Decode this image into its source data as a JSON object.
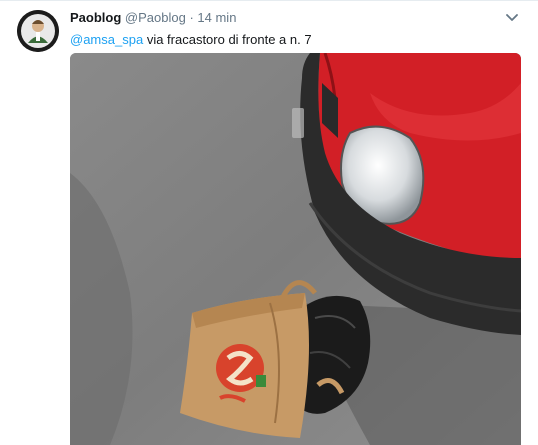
{
  "tweet": {
    "author_name": "Paoblog",
    "author_handle": "@Paoblog",
    "separator": "·",
    "timestamp": "14 min",
    "mention": "@amsa_spa",
    "text": "via fracastoro di fronte a n. 7"
  },
  "colors": {
    "mention": "#1da1f2",
    "car": "#d21f26",
    "asphalt": "#8d8d8d"
  },
  "icons": {
    "menu": "chevron-down-icon",
    "avatar": "avatar-icon"
  }
}
